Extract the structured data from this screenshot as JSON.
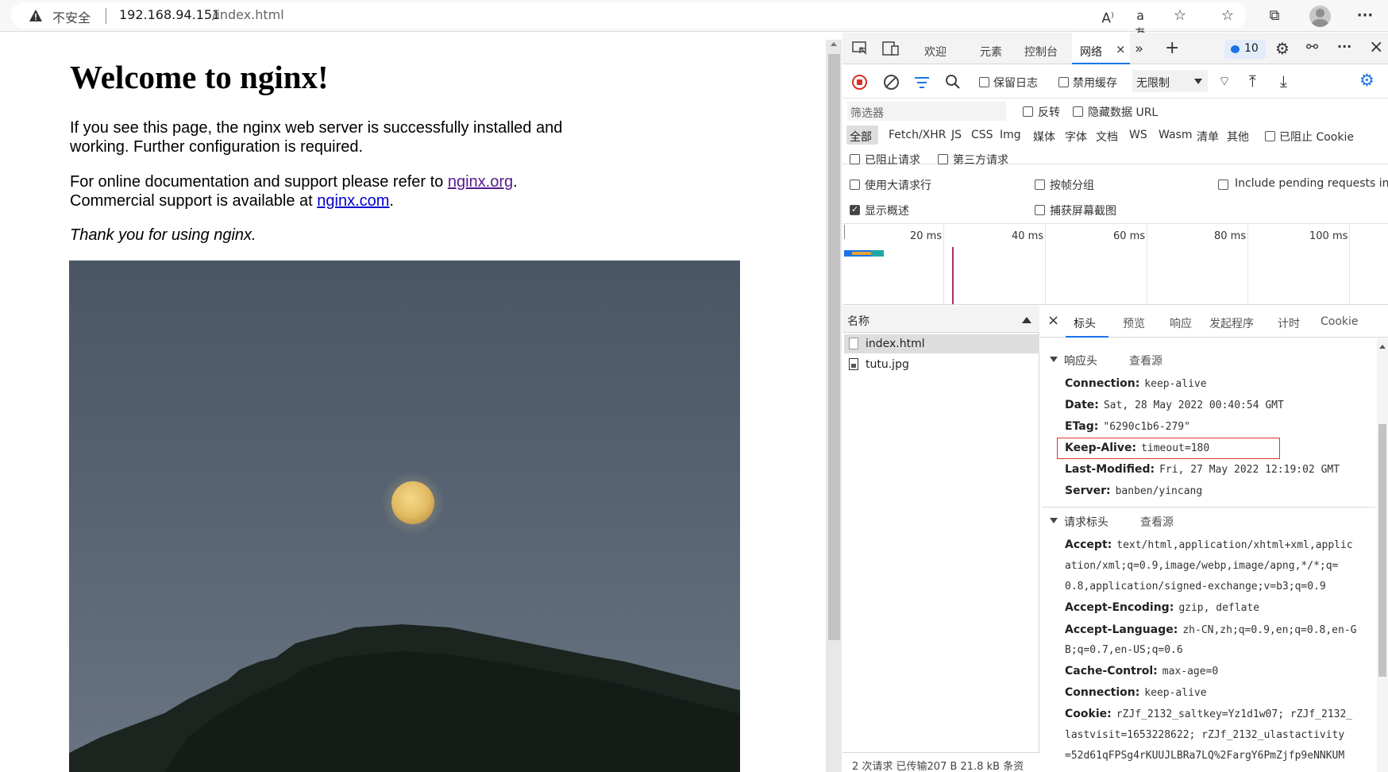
{
  "address_bar": {
    "security_label": "不安全",
    "url_host": "192.168.94.151",
    "url_path": "/index.html"
  },
  "page": {
    "title": "Welcome to nginx!",
    "para1_line1": "If you see this page, the nginx web server is successfully installed and",
    "para1_line2": "working. Further configuration is required.",
    "para2_prefix": "For online documentation and support please refer to ",
    "link1": "nginx.org",
    "para2_suffix": ".",
    "para3_prefix": "Commercial support is available at ",
    "link2": "nginx.com",
    "para3_suffix": ".",
    "thanks": "Thank you for using nginx."
  },
  "devtools": {
    "tabs": [
      "欢迎",
      "元素",
      "控制台",
      "网络"
    ],
    "active_tab": "网络",
    "issues_count": "10",
    "toolbar": {
      "preserve_log": "保留日志",
      "disable_cache": "禁用缓存",
      "throttle": "无限制"
    },
    "filter": {
      "placeholder": "筛选器",
      "invert": "反转",
      "hide_data_urls": "隐藏数据 URL",
      "types": [
        "全部",
        "Fetch/XHR",
        "JS",
        "CSS",
        "Img",
        "媒体",
        "字体",
        "文档",
        "WS",
        "Wasm",
        "清单",
        "其他"
      ],
      "blocked_cookies": "已阻止 Cookie",
      "blocked_requests": "已阻止请求",
      "third_party": "第三方请求"
    },
    "options": {
      "large_rows": "使用大请求行",
      "group_by_frame": "按帧分组",
      "include_pending": "Include pending requests in `",
      "show_overview": "显示概述",
      "capture_screenshots": "捕获屏幕截图"
    },
    "timeline": [
      "20 ms",
      "40 ms",
      "60 ms",
      "80 ms",
      "100 ms"
    ],
    "requests": {
      "column_name": "名称",
      "items": [
        "index.html",
        "tutu.jpg"
      ],
      "status": "2 次请求  已传输207 B  21.8 kB 条资"
    },
    "detail_tabs": [
      "标头",
      "预览",
      "响应",
      "发起程序",
      "计时",
      "Cookie"
    ],
    "response_headers": {
      "title": "响应头",
      "view_source": "查看源",
      "items": [
        {
          "k": "Connection:",
          "v": "keep-alive"
        },
        {
          "k": "Date:",
          "v": "Sat, 28 May 2022 00:40:54 GMT"
        },
        {
          "k": "ETag:",
          "v": "\"6290c1b6-279\""
        },
        {
          "k": "Keep-Alive:",
          "v": "timeout=180"
        },
        {
          "k": "Last-Modified:",
          "v": "Fri, 27 May 2022 12:19:02 GMT"
        },
        {
          "k": "Server:",
          "v": "banben/yincang"
        }
      ]
    },
    "request_headers": {
      "title": "请求标头",
      "view_source": "查看源",
      "accept_k": "Accept:",
      "accept_v1": "text/html,application/xhtml+xml,applic",
      "accept_v2": "ation/xml;q=0.9,image/webp,image/apng,*/*;q=",
      "accept_v3": "0.8,application/signed-exchange;v=b3;q=0.9",
      "enc_k": "Accept-Encoding:",
      "enc_v": "gzip, deflate",
      "lang_k": "Accept-Language:",
      "lang_v1": "zh-CN,zh;q=0.9,en;q=0.8,en-G",
      "lang_v2": "B;q=0.7,en-US;q=0.6",
      "cache_k": "Cache-Control:",
      "cache_v": "max-age=0",
      "conn_k": "Connection:",
      "conn_v": "keep-alive",
      "cookie_k": "Cookie:",
      "cookie_v1": "rZJf_2132_saltkey=Yz1d1w07; rZJf_2132_",
      "cookie_v2": "lastvisit=1653228622; rZJf_2132_ulastactivity",
      "cookie_v3": "=52d61qFPSg4rKUUJLBRa7LQ%2FargY6PmZjfp9eNNKUM"
    }
  }
}
